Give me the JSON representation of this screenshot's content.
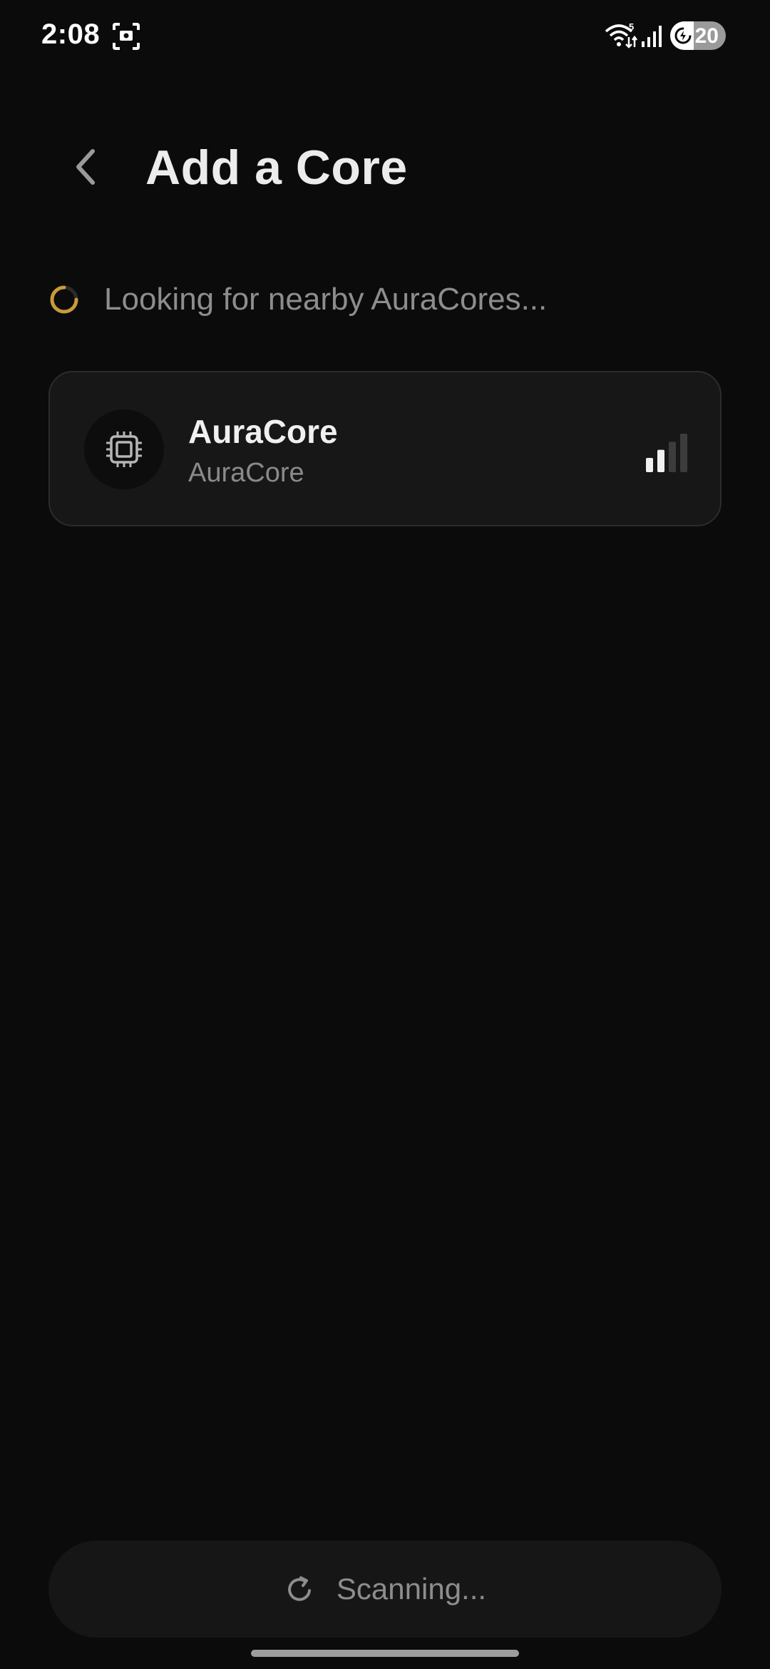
{
  "status_bar": {
    "time": "2:08",
    "battery_level": "20",
    "battery_fraction": 0.2,
    "wifi_badge": "5",
    "icons": [
      "screenshot-icon",
      "wifi-icon",
      "cellular-signal-icon",
      "battery-saver-icon"
    ]
  },
  "header": {
    "title": "Add a Core",
    "back_icon": "chevron-left-icon"
  },
  "scan_status": {
    "text": "Looking for nearby AuraCores...",
    "accent_color": "#c99a3a"
  },
  "devices": [
    {
      "name": "AuraCore",
      "subtitle": "AuraCore",
      "icon": "chip-icon",
      "signal_bars_active": 2,
      "signal_bars_total": 4
    }
  ],
  "bottom_button": {
    "label": "Scanning...",
    "icon": "refresh-icon"
  }
}
